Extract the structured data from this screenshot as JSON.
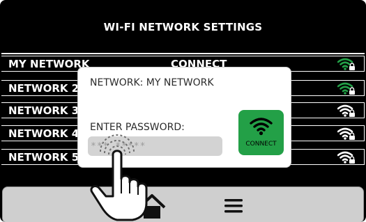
{
  "colors": {
    "screen_bg": "#000000",
    "wifi_green": "#23a047",
    "nav_bg": "#cfcfcf"
  },
  "header": {
    "title": "WI-FI NETWORK SETTINGS"
  },
  "networks": [
    {
      "name": "MY NETWORK",
      "action": "CONNECT",
      "wifi_icon": "wifi-locked-green-icon"
    },
    {
      "name": "NETWORK 2",
      "wifi_icon": "wifi-locked-green-icon"
    },
    {
      "name": "NETWORK 3",
      "wifi_icon": "wifi-locked-white-icon"
    },
    {
      "name": "NETWORK 4",
      "wifi_icon": "wifi-locked-white-icon"
    },
    {
      "name": "NETWORK 5",
      "wifi_icon": "wifi-locked-white-icon"
    }
  ],
  "dialog": {
    "network_label": "NETWORK: MY NETWORK",
    "password_label": "ENTER PASSWORD:",
    "password_value": "*** *****",
    "connect_label": "CONNECT",
    "connect_icon": "wifi-icon"
  },
  "nav": {
    "home_icon": "home-icon",
    "menu_icon": "menu-icon"
  },
  "overlay": {
    "icon": "tap-hand-icon"
  }
}
